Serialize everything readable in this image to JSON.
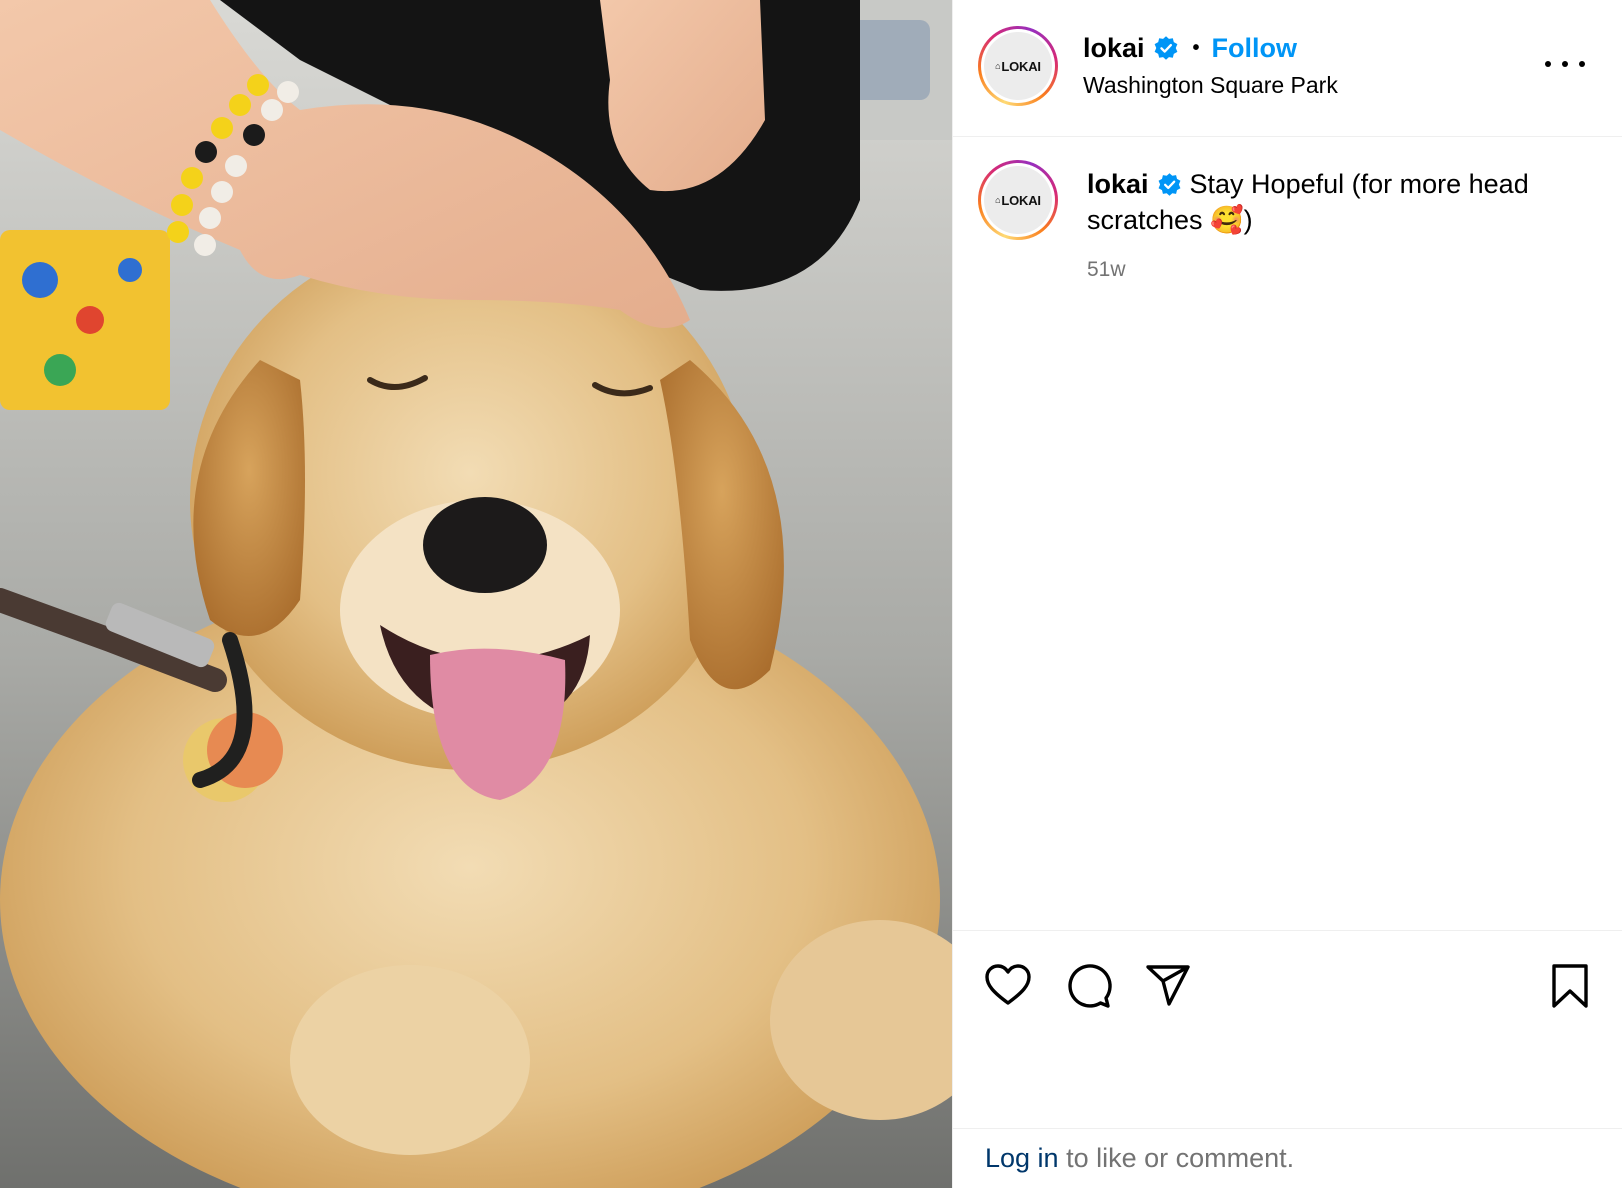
{
  "post": {
    "image_description_icon": "golden-retriever-puppy-photo",
    "author": {
      "username": "lokai",
      "verified": true,
      "avatar_text": "LOKAI",
      "avatar_mark": "⌂"
    },
    "header": {
      "separator": "•",
      "follow_label": "Follow",
      "location": "Washington Square Park",
      "more_icon": "more-horizontal-icon"
    },
    "caption": {
      "username": "lokai",
      "text": "Stay Hopeful (for more head scratches 🥰)",
      "timestamp": "51w"
    },
    "actions": {
      "like_icon": "heart-icon",
      "comment_icon": "comment-icon",
      "share_icon": "send-icon",
      "save_icon": "bookmark-icon"
    },
    "login": {
      "link_label": "Log in",
      "rest_label": " to like or comment."
    },
    "colors": {
      "follow_blue": "#0095f6",
      "verified_blue": "#0095f6",
      "login_link": "#00376b",
      "muted": "#737373"
    }
  }
}
